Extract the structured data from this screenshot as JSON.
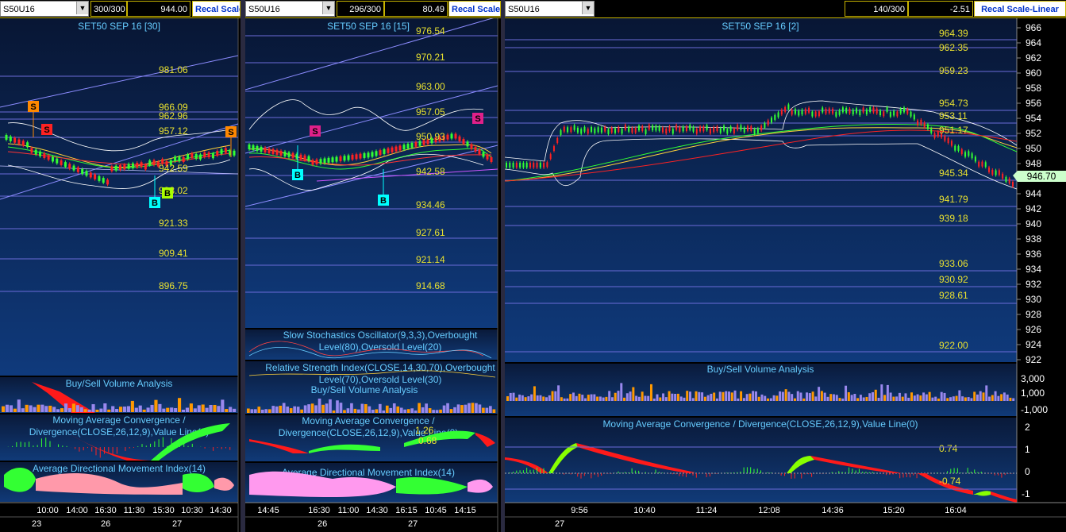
{
  "colors": {
    "bg_top": "#0a1a3a",
    "bg_bottom": "#113a7a",
    "hline": "#6b6bd8",
    "price_label": "#e8e030",
    "title": "#66ccff",
    "up": "#33ff33",
    "down": "#ff2222",
    "buy_sig": "#00ffff",
    "sell_sig": "#ff2222",
    "orange_sig": "#ff8800"
  },
  "panes": [
    {
      "symbol": "S50U16",
      "progress": "300/300",
      "value": "944.00",
      "recal": "Recal Scale",
      "title": "SET50 SEP 16  [30]",
      "price_levels": [
        "981.06",
        "966.09",
        "962.96",
        "957.12",
        "942.59",
        "933.02",
        "921.33",
        "909.41",
        "896.75"
      ],
      "signals": [
        {
          "label": "S"
        },
        {
          "label": "S"
        },
        {
          "label": "S"
        },
        {
          "label": "B"
        },
        {
          "label": "B"
        }
      ],
      "indicators": [
        "Buy/Sell Volume Analysis",
        "Moving Average Convergence /",
        "Divergence(CLOSE,26,12,9),Value Line(0)",
        "Average Directional Movement Index(14)"
      ],
      "time_labels": [
        "10:00",
        "14:00",
        "16:30",
        "11:30",
        "15:30",
        "10:30",
        "14:30"
      ],
      "date_labels": [
        "23",
        "26",
        "27"
      ]
    },
    {
      "symbol": "S50U16",
      "progress": "296/300",
      "value": "80.49",
      "recal": "Recal Scale",
      "title": "SET50 SEP 16  [15]",
      "price_levels": [
        "976.54",
        "970.21",
        "963.00",
        "957.05",
        "950.93",
        "942.58",
        "934.46",
        "927.61",
        "921.14",
        "914.68"
      ],
      "signals": [
        {
          "label": "S"
        },
        {
          "label": "S"
        },
        {
          "label": "B"
        },
        {
          "label": "B"
        }
      ],
      "indicators": [
        "Slow Stochastics Oscillator(9,3,3),Overbought",
        "Level(80),Oversold Level(20)",
        "Relative Strength Index(CLOSE,14,30,70),Overbought",
        "Level(70),Oversold Level(30)",
        "Buy/Sell Volume Analysis",
        "Moving Average Convergence /",
        "Divergence(CLOSE,26,12,9),Value Line(0)",
        "Average Directional Movement Index(14)"
      ],
      "macd_values": [
        "1.26",
        "0.68"
      ],
      "time_labels": [
        "14:45",
        "16:30",
        "11:00",
        "14:30",
        "16:15",
        "10:45",
        "14:15"
      ],
      "date_labels": [
        "26",
        "27"
      ]
    },
    {
      "symbol": "S50U16",
      "progress": "140/300",
      "value": "-2.51",
      "recal": "Recal Scale-Linear",
      "title": "SET50 SEP 16  [2]",
      "price_levels": [
        "964.39",
        "962.35",
        "959.23",
        "954.73",
        "953.11",
        "951.17",
        "945.34",
        "941.79",
        "939.18",
        "933.06",
        "930.92",
        "928.61",
        "922.00"
      ],
      "axis_labels": [
        "966",
        "964",
        "962",
        "960",
        "958",
        "956",
        "954",
        "952",
        "950",
        "948",
        "946",
        "944",
        "942",
        "940",
        "938",
        "936",
        "934",
        "932",
        "930",
        "928",
        "926",
        "924",
        "922"
      ],
      "last_price": "946.70",
      "indicators": [
        "Buy/Sell Volume Analysis",
        "Moving Average Convergence / Divergence(CLOSE,26,12,9),Value Line(0)"
      ],
      "volume_axis": [
        "3,000",
        "1,000",
        "-1,000"
      ],
      "macd_axis": [
        "2",
        "1",
        "0",
        "-1"
      ],
      "macd_values": [
        "0.74",
        "-0.74"
      ],
      "time_labels": [
        "9:56",
        "10:40",
        "11:24",
        "12:08",
        "14:36",
        "15:20",
        "16:04"
      ],
      "date_labels": [
        "27"
      ]
    }
  ]
}
